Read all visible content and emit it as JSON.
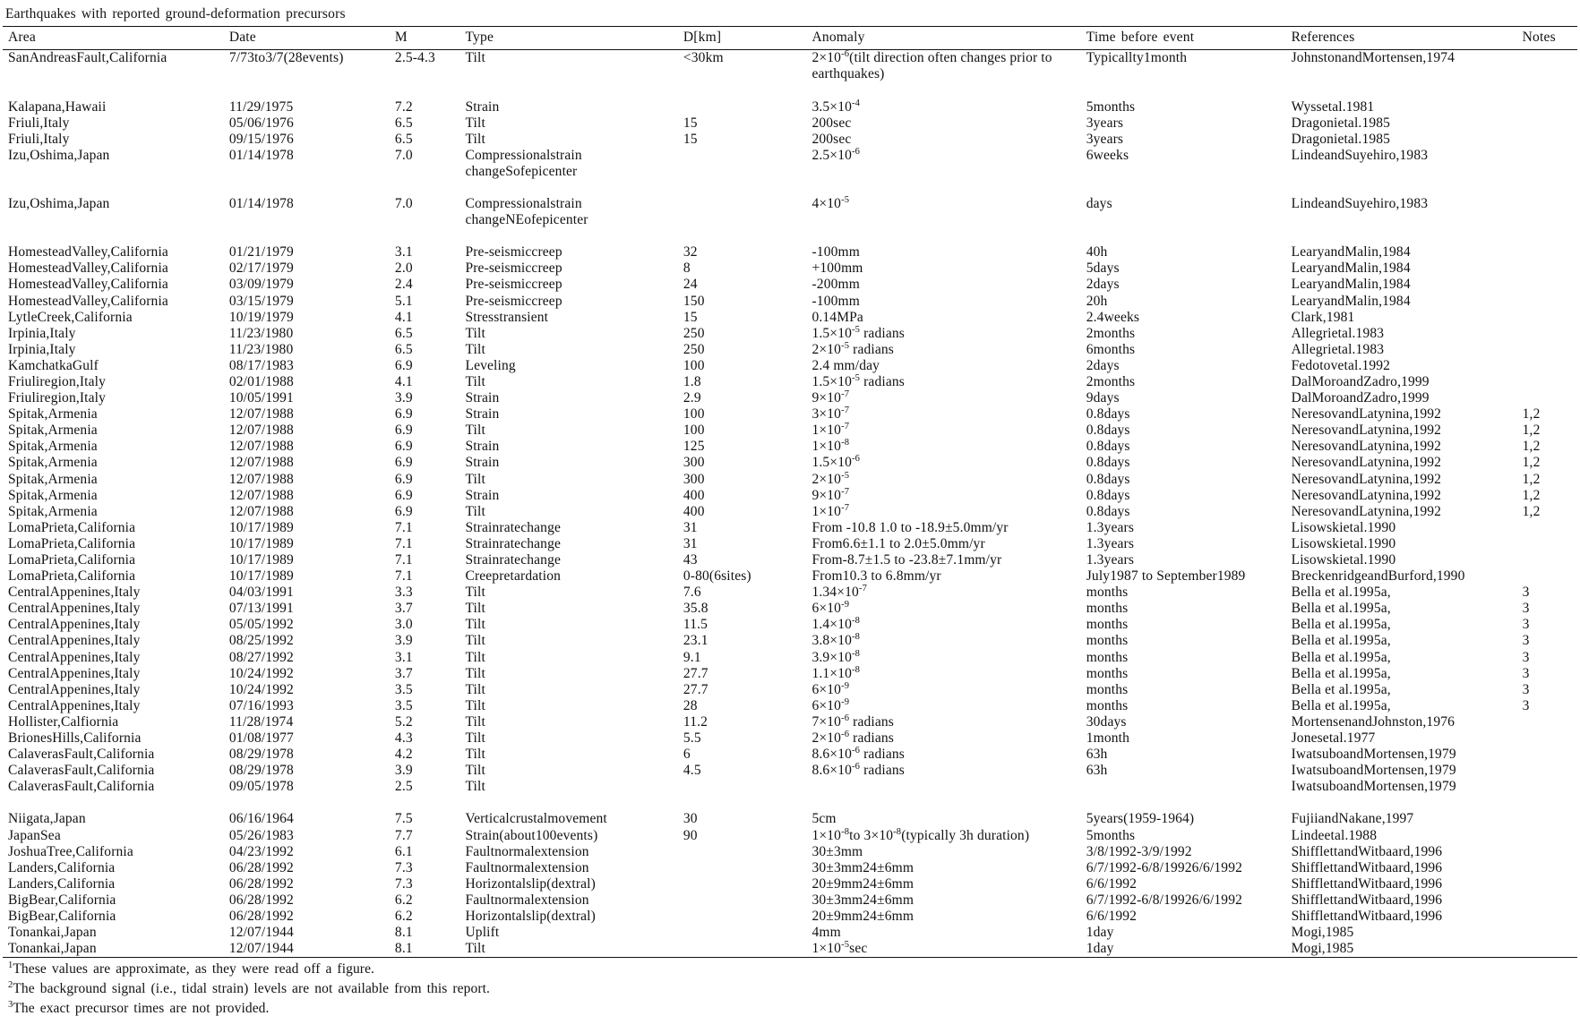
{
  "caption": "Earthquakes with reported ground-deformation precursors",
  "columns": [
    "Area",
    "Date",
    "M",
    "Type",
    "D[km]",
    "Anomaly",
    "Time before event",
    "References",
    "Notes"
  ],
  "rows": [
    {
      "area": "SanAndreasFault,California",
      "date": "7/73to3/7(28events)",
      "m": "2.5-4.3",
      "type": "Tilt",
      "d": "<30km",
      "anomaly": "2×10⁻⁶(tilt direction often changes prior to earthquakes)",
      "anomaly_html": "2×10<sup>-6</sup>(tilt direction often changes prior to earthquakes)",
      "time": "Typicallty1month",
      "reference": "JohnstonandMortensen,1974",
      "notes": ""
    },
    {
      "area": "Kalapana,Hawaii",
      "date": "11/29/1975",
      "m": "7.2",
      "type": "Strain",
      "d": "",
      "anomaly": "3.5×10⁻⁴",
      "anomaly_html": "3.5×10<sup>-4</sup>",
      "time": "5months",
      "reference": "Wyssetal.1981",
      "notes": ""
    },
    {
      "area": "Friuli,Italy",
      "date": "05/06/1976",
      "m": "6.5",
      "type": "Tilt",
      "d": "15",
      "anomaly": "200sec",
      "anomaly_html": "200sec",
      "time": "3years",
      "reference": "Dragonietal.1985",
      "notes": ""
    },
    {
      "area": "Friuli,Italy",
      "date": "09/15/1976",
      "m": "6.5",
      "type": "Tilt",
      "d": "15",
      "anomaly": "200sec",
      "anomaly_html": "200sec",
      "time": "3years",
      "reference": "Dragonietal.1985",
      "notes": ""
    },
    {
      "area": "Izu,Oshima,Japan",
      "date": "01/14/1978",
      "m": "7.0",
      "type": "Compressionalstrain changeSofepicenter",
      "d": "",
      "anomaly": "2.5×10⁻⁶",
      "anomaly_html": "2.5×10<sup>-6</sup>",
      "time": "6weeks",
      "reference": "LindeandSuyehiro,1983",
      "notes": ""
    },
    {
      "area": "Izu,Oshima,Japan",
      "date": "01/14/1978",
      "m": "7.0",
      "type": "Compressionalstrain changeNEofepicenter",
      "d": "",
      "anomaly": "4×10⁻⁵",
      "anomaly_html": "4×10<sup>-5</sup>",
      "time": "days",
      "reference": "LindeandSuyehiro,1983",
      "notes": ""
    },
    {
      "area": "HomesteadValley,California",
      "date": "01/21/1979",
      "m": "3.1",
      "type": "Pre-seismiccreep",
      "d": "32",
      "anomaly": "-100mm",
      "anomaly_html": "-100mm",
      "time": "40h",
      "reference": "LearyandMalin,1984",
      "notes": ""
    },
    {
      "area": "HomesteadValley,California",
      "date": "02/17/1979",
      "m": "2.0",
      "type": "Pre-seismiccreep",
      "d": "8",
      "anomaly": "+100mm",
      "anomaly_html": "+100mm",
      "time": "5days",
      "reference": "LearyandMalin,1984",
      "notes": ""
    },
    {
      "area": "HomesteadValley,California",
      "date": "03/09/1979",
      "m": "2.4",
      "type": "Pre-seismiccreep",
      "d": "24",
      "anomaly": "-200mm",
      "anomaly_html": "-200mm",
      "time": "2days",
      "reference": "LearyandMalin,1984",
      "notes": ""
    },
    {
      "area": "HomesteadValley,California",
      "date": "03/15/1979",
      "m": "5.1",
      "type": "Pre-seismiccreep",
      "d": "150",
      "anomaly": "-100mm",
      "anomaly_html": "-100mm",
      "time": "20h",
      "reference": "LearyandMalin,1984",
      "notes": ""
    },
    {
      "area": "LytleCreek,California",
      "date": "10/19/1979",
      "m": "4.1",
      "type": "Stresstransient",
      "d": "15",
      "anomaly": "0.14MPa",
      "anomaly_html": "0.14MPa",
      "time": "2.4weeks",
      "reference": "Clark,1981",
      "notes": ""
    },
    {
      "area": "Irpinia,Italy",
      "date": "11/23/1980",
      "m": "6.5",
      "type": "Tilt",
      "d": "250",
      "anomaly": "1.5×10⁻⁵ radians",
      "anomaly_html": "1.5×10<sup>-5</sup> radians",
      "time": "2months",
      "reference": "Allegrietal.1983",
      "notes": ""
    },
    {
      "area": "Irpinia,Italy",
      "date": "11/23/1980",
      "m": "6.5",
      "type": "Tilt",
      "d": "250",
      "anomaly": "2×10⁻⁵ radians",
      "anomaly_html": "2×10<sup>-5</sup> radians",
      "time": "6months",
      "reference": "Allegrietal.1983",
      "notes": ""
    },
    {
      "area": "KamchatkaGulf",
      "date": "08/17/1983",
      "m": "6.9",
      "type": "Leveling",
      "d": "100",
      "anomaly": "2.4 mm/day",
      "anomaly_html": "2.4 mm/day",
      "time": "2days",
      "reference": "Fedotovetal.1992",
      "notes": ""
    },
    {
      "area": "Friuliregion,Italy",
      "date": "02/01/1988",
      "m": "4.1",
      "type": "Tilt",
      "d": "1.8",
      "anomaly": "1.5×10⁻⁵ radians",
      "anomaly_html": "1.5×10<sup>-5</sup> radians",
      "time": "2months",
      "reference": "DalMoroandZadro,1999",
      "notes": ""
    },
    {
      "area": "Friuliregion,Italy",
      "date": "10/05/1991",
      "m": "3.9",
      "type": "Strain",
      "d": "2.9",
      "anomaly": "9×10⁻⁷",
      "anomaly_html": "9×10<sup>-7</sup>",
      "time": "9days",
      "reference": "DalMoroandZadro,1999",
      "notes": ""
    },
    {
      "area": "Spitak,Armenia",
      "date": "12/07/1988",
      "m": "6.9",
      "type": "Strain",
      "d": "100",
      "anomaly": "3×10⁻⁷",
      "anomaly_html": "3×10<sup>-7</sup>",
      "time": "0.8days",
      "reference": "NeresovandLatynina,1992",
      "notes": "1,2"
    },
    {
      "area": "Spitak,Armenia",
      "date": "12/07/1988",
      "m": "6.9",
      "type": "Tilt",
      "d": "100",
      "anomaly": "1×10⁻⁷",
      "anomaly_html": "1×10<sup>-7</sup>",
      "time": "0.8days",
      "reference": "NeresovandLatynina,1992",
      "notes": "1,2"
    },
    {
      "area": "Spitak,Armenia",
      "date": "12/07/1988",
      "m": "6.9",
      "type": "Strain",
      "d": "125",
      "anomaly": "1×10⁻⁸",
      "anomaly_html": "1×10<sup>-8</sup>",
      "time": "0.8days",
      "reference": "NeresovandLatynina,1992",
      "notes": "1,2"
    },
    {
      "area": "Spitak,Armenia",
      "date": "12/07/1988",
      "m": "6.9",
      "type": "Strain",
      "d": "300",
      "anomaly": "1.5×10⁻⁶",
      "anomaly_html": "1.5×10<sup>-6</sup>",
      "time": "0.8days",
      "reference": "NeresovandLatynina,1992",
      "notes": "1,2"
    },
    {
      "area": "Spitak,Armenia",
      "date": "12/07/1988",
      "m": "6.9",
      "type": "Tilt",
      "d": "300",
      "anomaly": "2×10⁻⁵",
      "anomaly_html": "2×10<sup>-5</sup>",
      "time": "0.8days",
      "reference": "NeresovandLatynina,1992",
      "notes": "1,2"
    },
    {
      "area": "Spitak,Armenia",
      "date": "12/07/1988",
      "m": "6.9",
      "type": "Strain",
      "d": "400",
      "anomaly": "9×10⁻⁷",
      "anomaly_html": "9×10<sup>-7</sup>",
      "time": "0.8days",
      "reference": "NeresovandLatynina,1992",
      "notes": "1,2"
    },
    {
      "area": "Spitak,Armenia",
      "date": "12/07/1988",
      "m": "6.9",
      "type": "Tilt",
      "d": "400",
      "anomaly": "1×10⁻⁷",
      "anomaly_html": "1×10<sup>-7</sup>",
      "time": "0.8days",
      "reference": "NeresovandLatynina,1992",
      "notes": "1,2"
    },
    {
      "area": "LomaPrieta,California",
      "date": "10/17/1989",
      "m": "7.1",
      "type": "Strainratechange",
      "d": "31",
      "anomaly": "From -10.8 1.0 to -18.9±5.0mm/yr",
      "anomaly_html": "From -10.8 1.0 to -18.9±5.0mm/yr",
      "time": "1.3years",
      "reference": "Lisowskietal.1990",
      "notes": ""
    },
    {
      "area": "LomaPrieta,California",
      "date": "10/17/1989",
      "m": "7.1",
      "type": "Strainratechange",
      "d": "31",
      "anomaly": "From6.6±1.1 to 2.0±5.0mm/yr",
      "anomaly_html": "From6.6±1.1 to 2.0±5.0mm/yr",
      "time": "1.3years",
      "reference": "Lisowskietal.1990",
      "notes": ""
    },
    {
      "area": "LomaPrieta,California",
      "date": "10/17/1989",
      "m": "7.1",
      "type": "Strainratechange",
      "d": "43",
      "anomaly": "From-8.7±1.5 to -23.8±7.1mm/yr",
      "anomaly_html": "From-8.7±1.5 to -23.8±7.1mm/yr",
      "time": "1.3years",
      "reference": "Lisowskietal.1990",
      "notes": ""
    },
    {
      "area": "LomaPrieta,California",
      "date": "10/17/1989",
      "m": "7.1",
      "type": "Creepretardation",
      "d": "0-80(6sites)",
      "anomaly": "From10.3 to 6.8mm/yr",
      "anomaly_html": "From10.3 to 6.8mm/yr",
      "time": "July1987 to September1989",
      "reference": "BreckenridgeandBurford,1990",
      "notes": ""
    },
    {
      "area": "CentralAppenines,Italy",
      "date": "04/03/1991",
      "m": "3.3",
      "type": "Tilt",
      "d": "7.6",
      "anomaly": "1.34×10⁻⁷",
      "anomaly_html": "1.34×10<sup>-7</sup>",
      "time": "months",
      "reference": "Bella et al.1995a,",
      "notes": "3"
    },
    {
      "area": "CentralAppenines,Italy",
      "date": "07/13/1991",
      "m": "3.7",
      "type": "Tilt",
      "d": "35.8",
      "anomaly": "6×10⁻⁹",
      "anomaly_html": "6×10<sup>-9</sup>",
      "time": "months",
      "reference": "Bella et al.1995a,",
      "notes": "3"
    },
    {
      "area": "CentralAppenines,Italy",
      "date": "05/05/1992",
      "m": "3.0",
      "type": "Tilt",
      "d": "11.5",
      "anomaly": "1.4×10⁻⁸",
      "anomaly_html": "1.4×10<sup>-8</sup>",
      "time": "months",
      "reference": "Bella et al.1995a,",
      "notes": "3"
    },
    {
      "area": "CentralAppenines,Italy",
      "date": "08/25/1992",
      "m": "3.9",
      "type": "Tilt",
      "d": "23.1",
      "anomaly": "3.8×10⁻⁸",
      "anomaly_html": "3.8×10<sup>-8</sup>",
      "time": "months",
      "reference": "Bella et al.1995a,",
      "notes": "3"
    },
    {
      "area": "CentralAppenines,Italy",
      "date": "08/27/1992",
      "m": "3.1",
      "type": "Tilt",
      "d": "9.1",
      "anomaly": "3.9×10⁻⁸",
      "anomaly_html": "3.9×10<sup>-8</sup>",
      "time": "months",
      "reference": "Bella et al.1995a,",
      "notes": "3"
    },
    {
      "area": "CentralAppenines,Italy",
      "date": "10/24/1992",
      "m": "3.7",
      "type": "Tilt",
      "d": "27.7",
      "anomaly": "1.1×10⁻⁸",
      "anomaly_html": "1.1×10<sup>-8</sup>",
      "time": "months",
      "reference": "Bella et al.1995a,",
      "notes": "3"
    },
    {
      "area": "CentralAppenines,Italy",
      "date": "10/24/1992",
      "m": "3.5",
      "type": "Tilt",
      "d": "27.7",
      "anomaly": "6×10⁻⁹",
      "anomaly_html": "6×10<sup>-9</sup>",
      "time": "months",
      "reference": "Bella et al.1995a,",
      "notes": "3"
    },
    {
      "area": "CentralAppenines,Italy",
      "date": "07/16/1993",
      "m": "3.5",
      "type": "Tilt",
      "d": "28",
      "anomaly": "6×10⁻⁹",
      "anomaly_html": "6×10<sup>-9</sup>",
      "time": "months",
      "reference": "Bella et al.1995a,",
      "notes": "3"
    },
    {
      "area": "Hollister,Calfiornia",
      "date": "11/28/1974",
      "m": "5.2",
      "type": "Tilt",
      "d": "11.2",
      "anomaly": "7×10⁻⁶ radians",
      "anomaly_html": "7×10<sup>-6</sup> radians",
      "time": "30days",
      "reference": "MortensenandJohnston,1976",
      "notes": ""
    },
    {
      "area": "BrionesHills,California",
      "date": "01/08/1977",
      "m": "4.3",
      "type": "Tilt",
      "d": "5.5",
      "anomaly": "2×10⁻⁶ radians",
      "anomaly_html": "2×10<sup>-6</sup> radians",
      "time": "1month",
      "reference": "Jonesetal.1977",
      "notes": ""
    },
    {
      "area": "CalaverasFault,California",
      "date": "08/29/1978",
      "m": "4.2",
      "type": "Tilt",
      "d": "6",
      "anomaly": "8.6×10⁻⁶ radians",
      "anomaly_html": "8.6×10<sup>-6</sup> radians",
      "time": "63h",
      "reference": "IwatsuboandMortensen,1979",
      "notes": ""
    },
    {
      "area": "CalaverasFault,California",
      "date": "08/29/1978",
      "m": "3.9",
      "type": "Tilt",
      "d": "4.5",
      "anomaly": "8.6×10⁻⁶ radians",
      "anomaly_html": "8.6×10<sup>-6</sup> radians",
      "time": "63h",
      "reference": "IwatsuboandMortensen,1979",
      "notes": ""
    },
    {
      "area": "CalaverasFault,California",
      "date": "09/05/1978",
      "m": "2.5",
      "type": "Tilt",
      "d": "",
      "anomaly": "",
      "anomaly_html": "",
      "time": "",
      "reference": "IwatsuboandMortensen,1979",
      "notes": ""
    },
    {
      "area": "Niigata,Japan",
      "date": "06/16/1964",
      "m": "7.5",
      "type": "Verticalcrustalmovement",
      "d": "30",
      "anomaly": "5cm",
      "anomaly_html": "5cm",
      "time": "5years(1959-1964)",
      "reference": "FujiiandNakane,1997",
      "notes": ""
    },
    {
      "area": "JapanSea",
      "date": "05/26/1983",
      "m": "7.7",
      "type": "Strain(about100events)",
      "d": "90",
      "anomaly": "1×10⁻⁸to 3×10⁻⁸(typically 3h duration)",
      "anomaly_html": "1×10<sup>-8</sup>to 3×10<sup>-8</sup>(typically 3h duration)",
      "time": "5months",
      "reference": "Lindeetal.1988",
      "notes": ""
    },
    {
      "area": "JoshuaTree,California",
      "date": "04/23/1992",
      "m": "6.1",
      "type": "Faultnormalextension",
      "d": "",
      "anomaly": "30±3mm",
      "anomaly_html": "30±3mm",
      "time": "3/8/1992-3/9/1992",
      "reference": "ShifflettandWitbaard,1996",
      "notes": ""
    },
    {
      "area": "Landers,California",
      "date": "06/28/1992",
      "m": "7.3",
      "type": "Faultnormalextension",
      "d": "",
      "anomaly": "30±3mm24±6mm",
      "anomaly_html": "30±3mm24±6mm",
      "time": "6/7/1992-6/8/19926/6/1992",
      "reference": "ShifflettandWitbaard,1996",
      "notes": ""
    },
    {
      "area": "Landers,California",
      "date": "06/28/1992",
      "m": "7.3",
      "type": "Horizontalslip(dextral)",
      "d": "",
      "anomaly": "20±9mm24±6mm",
      "anomaly_html": "20±9mm24±6mm",
      "time": "6/6/1992",
      "reference": "ShifflettandWitbaard,1996",
      "notes": ""
    },
    {
      "area": "BigBear,California",
      "date": "06/28/1992",
      "m": "6.2",
      "type": "Faultnormalextension",
      "d": "",
      "anomaly": "30±3mm24±6mm",
      "anomaly_html": "30±3mm24±6mm",
      "time": "6/7/1992-6/8/19926/6/1992",
      "reference": "ShifflettandWitbaard,1996",
      "notes": ""
    },
    {
      "area": "BigBear,California",
      "date": "06/28/1992",
      "m": "6.2",
      "type": "Horizontalslip(dextral)",
      "d": "",
      "anomaly": "20±9mm24±6mm",
      "anomaly_html": "20±9mm24±6mm",
      "time": "6/6/1992",
      "reference": "ShifflettandWitbaard,1996",
      "notes": ""
    },
    {
      "area": "Tonankai,Japan",
      "date": "12/07/1944",
      "m": "8.1",
      "type": "Uplift",
      "d": "",
      "anomaly": "4mm",
      "anomaly_html": "4mm",
      "time": "1day",
      "reference": "Mogi,1985",
      "notes": ""
    },
    {
      "area": "Tonankai,Japan",
      "date": "12/07/1944",
      "m": "8.1",
      "type": "Tilt",
      "d": "",
      "anomaly": "1×10⁻⁵sec",
      "anomaly_html": "1×10<sup>-5</sup>sec",
      "time": "1day",
      "reference": "Mogi,1985",
      "notes": ""
    }
  ],
  "footnotes": [
    {
      "mark": "1",
      "text": "These values are approximate, as they were read off a figure."
    },
    {
      "mark": "2",
      "text": "The background signal (i.e., tidal strain) levels are not available from this report."
    },
    {
      "mark": "3",
      "text": "The exact precursor times are not provided."
    }
  ]
}
